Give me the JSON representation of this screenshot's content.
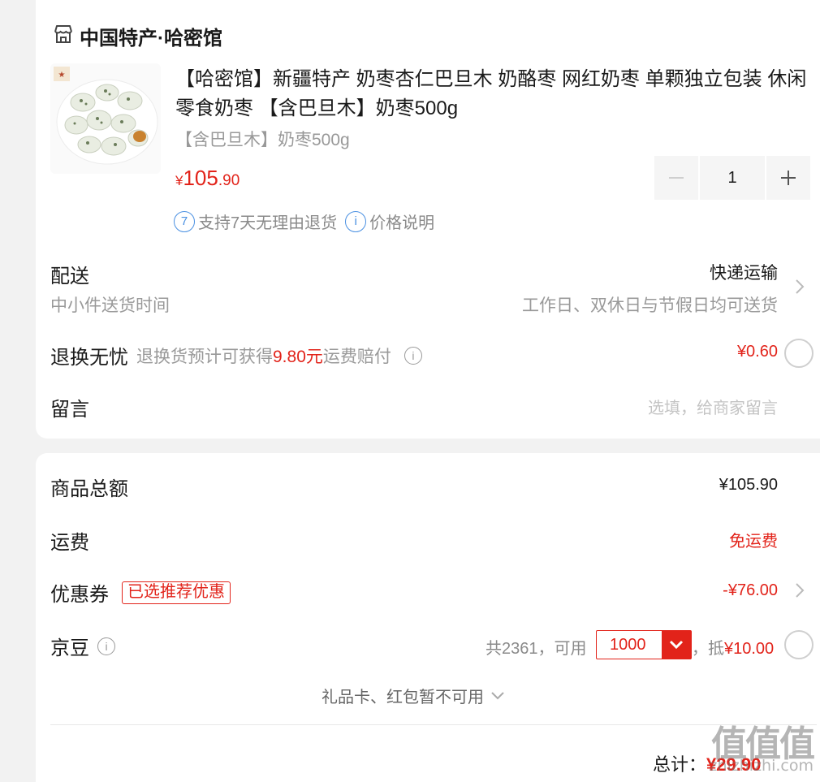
{
  "shop": {
    "name": "中国特产·哈密馆",
    "icon": "store-icon"
  },
  "product": {
    "title": "【哈密馆】新疆特产 奶枣杏仁巴旦木 奶酪枣 网红奶枣 单颗独立包装 休闲零食奶枣 【含巴旦木】奶枣500g",
    "spec": "【含巴旦木】奶枣500g",
    "price_symbol": "¥",
    "price_int": "105",
    "price_dec": ".90",
    "quantity": "1",
    "tag_return_icon_text": "7",
    "tag_return": "支持7天无理由退货",
    "tag_price_icon_text": "i",
    "tag_price": "价格说明"
  },
  "delivery": {
    "label": "配送",
    "sub": "中小件送货时间",
    "method": "快递运输",
    "time": "工作日、双休日与节假日均可送货"
  },
  "return_service": {
    "label": "退换无忧",
    "desc_prefix": "退换货预计可获得",
    "desc_amount": "9.80元",
    "desc_suffix": "运费赔付",
    "price": "¥0.60"
  },
  "message": {
    "label": "留言",
    "placeholder": "选填，给商家留言"
  },
  "summary": {
    "goods_total_label": "商品总额",
    "goods_total_value": "¥105.90",
    "shipping_label": "运费",
    "shipping_value": "免运费",
    "coupon_label": "优惠券",
    "coupon_tag": "已选推荐优惠",
    "coupon_value": "-¥76.00",
    "beans_label": "京豆",
    "beans_total_text": "共2361，可用",
    "beans_selected": "1000",
    "beans_deduct_prefix": "，抵",
    "beans_deduct_value": "¥10.00",
    "giftcard_text": "礼品卡、红包暂不可用",
    "total_label": "总计：",
    "total_value": "¥29.90"
  },
  "watermark": {
    "logo": "值值值",
    "site": "zhizhizhi.com"
  },
  "colors": {
    "accent_red": "#e2231a",
    "info_blue": "#4a90e2",
    "gray_text": "#999999"
  }
}
